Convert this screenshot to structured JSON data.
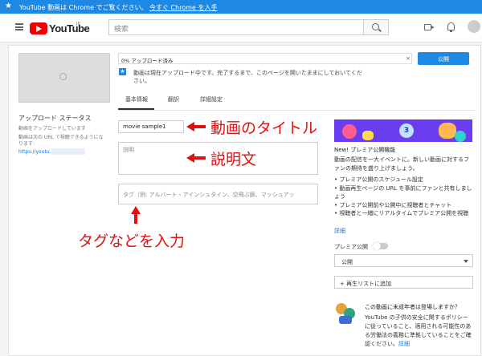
{
  "promo": {
    "message": "YouTube 動画は Chrome でご覧ください。",
    "link": "今すぐ Chrome を入手"
  },
  "header": {
    "search_placeholder": "検索",
    "logo_text": "YouTube",
    "logo_region": "JP"
  },
  "sidebar": {
    "status_title": "アップロード ステータス",
    "status_sub": "動画をアップロードしています",
    "url_label": "動画は次の URL で視聴できるようになります:",
    "url": "https://youtu.be/"
  },
  "progress": {
    "text": "0% アップロード済み",
    "close": "×",
    "publish_label": "公開"
  },
  "info": {
    "message": "動画は現在アップロード中です。完了するまで、このページを開いたままにしておいてください。"
  },
  "tabs": [
    {
      "label": "基本情報"
    },
    {
      "label": "翻訳"
    },
    {
      "label": "詳細設定"
    }
  ],
  "form": {
    "title_value": "movie sample1",
    "desc_placeholder": "説明",
    "tag_placeholder": "タグ（例: アルバート・アインシュタイン、空飛ぶ豚、マッシュアッ"
  },
  "annotations": {
    "title_note": "動画のタイトル",
    "desc_note": "説明文",
    "tag_note": "タグなどを入力",
    "color": "#e01010"
  },
  "premiere": {
    "banner_number": "3",
    "title": "New! プレミア公開機能",
    "desc": "動画の配信を一大イベントに。新しい動画に対するファンの期待を盛り上げましょう。",
    "items": [
      "• プレミア公開のスケジュール設定",
      "• 動画再生ページの URL を事前にファンと共有しましょう",
      "• プレミア公開前や公開中に視聴者とチャット",
      "• 視聴者と一緒にリアルタイムでプレミア公開を視聴"
    ],
    "details_link": "詳細",
    "toggle_label": "プレミア公開",
    "toggle_on": false,
    "visibility": "公開",
    "playlist_button": "+ 再生リストに追加"
  },
  "kids": {
    "question": "この動画に未成年者は登場しますか？",
    "desc": "YouTube の子供の安全に関するポリシーに従っていること、適用される可能性のある労働法の義務に準拠していることをご確認ください。",
    "details_link": "詳細"
  }
}
